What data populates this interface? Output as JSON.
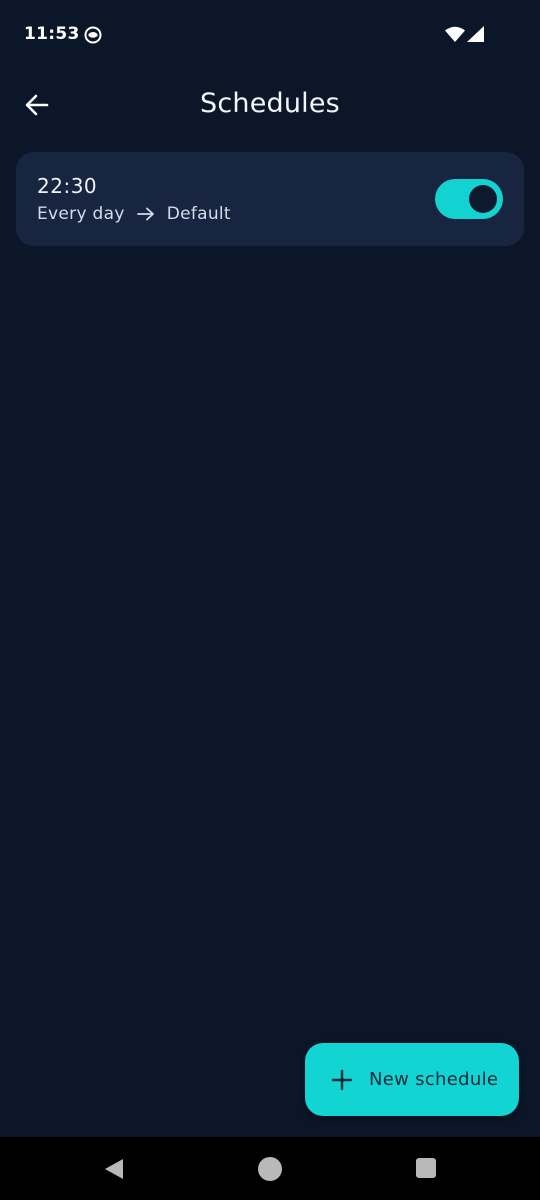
{
  "status_bar": {
    "time": "11:53",
    "icons": [
      "app-notification-icon",
      "wifi-icon",
      "cell-signal-icon"
    ]
  },
  "app_bar": {
    "back_icon": "arrow-back-icon",
    "title": "Schedules"
  },
  "schedules": [
    {
      "time": "22:30",
      "repeat": "Every day",
      "arrow_icon": "arrow-right-icon",
      "profile": "Default",
      "enabled": true
    }
  ],
  "fab": {
    "icon": "plus-icon",
    "label": "New schedule"
  },
  "navigation_bar": {
    "icons": [
      "nav-back-icon",
      "nav-home-icon",
      "nav-recents-icon"
    ]
  },
  "colors": {
    "background": "#0b1629",
    "card": "#172540",
    "accent": "#12d5d3",
    "nav_bar": "#000000"
  }
}
